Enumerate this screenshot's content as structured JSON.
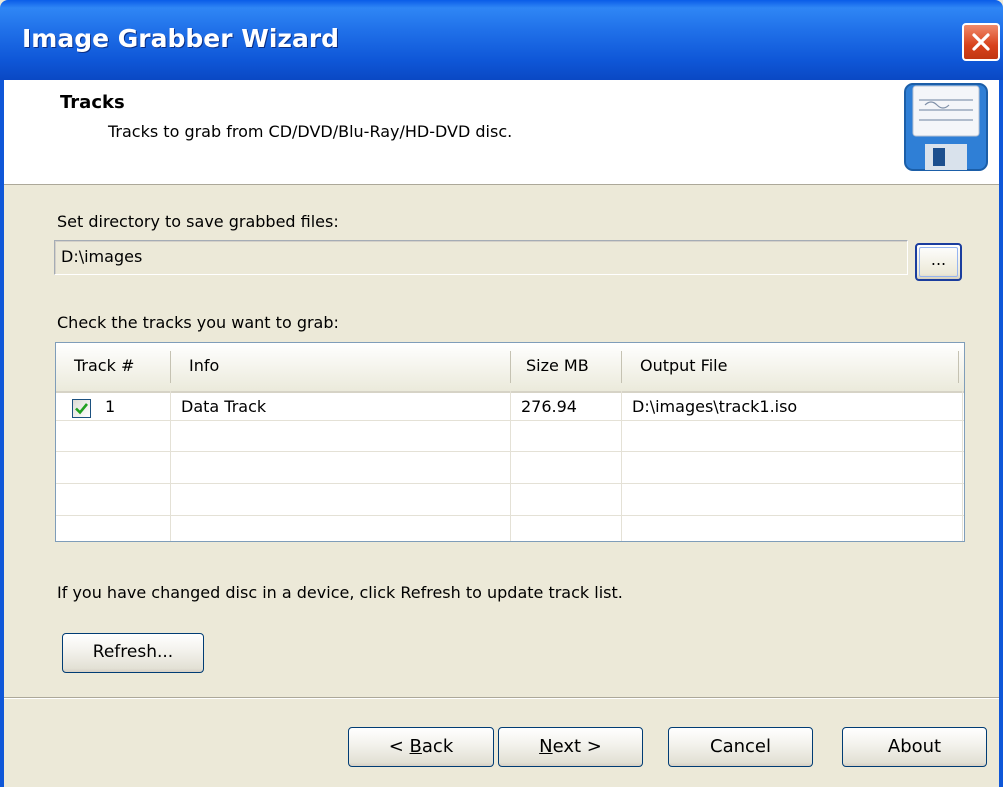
{
  "window": {
    "title": "Image Grabber Wizard",
    "close_label": "×"
  },
  "header": {
    "title": "Tracks",
    "subtitle": "Tracks to grab from CD/DVD/Blu-Ray/HD-DVD disc.",
    "icon": "floppy-disk-icon"
  },
  "directory": {
    "label": "Set directory to save grabbed files:",
    "value": "D:\\images",
    "browse_label": "..."
  },
  "tracks": {
    "label": "Check the tracks you want to grab:",
    "columns": [
      "Track #",
      "Info",
      "Size MB",
      "Output File"
    ],
    "rows": [
      {
        "checked": true,
        "track": "1",
        "info": "Data Track",
        "size": "276.94",
        "output": "D:\\images\\track1.iso"
      }
    ]
  },
  "refresh": {
    "hint": "If you have changed disc in a device, click Refresh to update track list.",
    "button_label": "Refresh..."
  },
  "buttons": {
    "back_prefix": "< ",
    "back_mnemonic": "B",
    "back_rest": "ack",
    "next_mnemonic": "N",
    "next_rest": "ext >",
    "cancel": "Cancel",
    "about": "About"
  },
  "colors": {
    "titlebar": "#0f57d8",
    "dialog_bg": "#ece9d8",
    "close_button": "#d8421c"
  }
}
